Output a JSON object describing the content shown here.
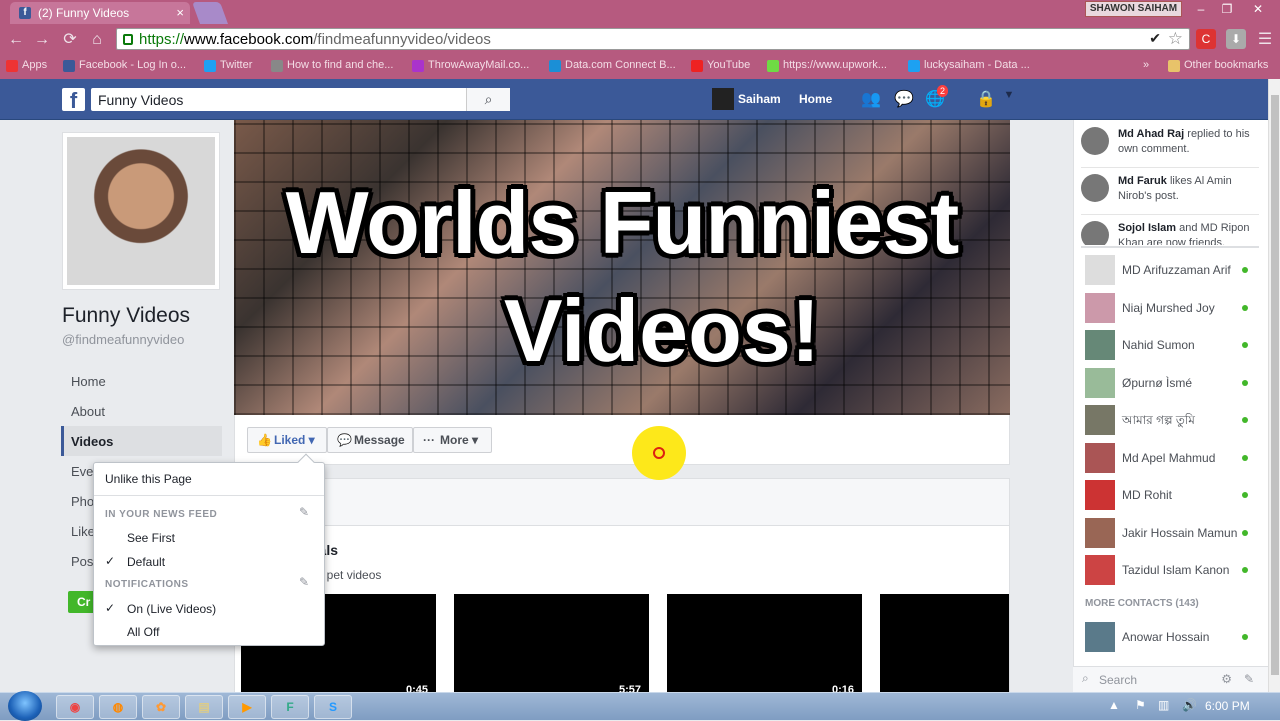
{
  "browser": {
    "tab_title": "(2) Funny Videos",
    "tab_close": "×",
    "user_chip": "SHAWON SAIHAM",
    "window_buttons": [
      "–",
      "❐",
      "✕"
    ],
    "nav": [
      "←",
      "→",
      "⟳",
      "⌂"
    ],
    "url_https": "https://",
    "url_host": "www.facebook.com",
    "url_path": "/findmeafunnyvideo/videos",
    "menu_glyph": "☰",
    "bookmarks": [
      {
        "label": "Apps",
        "color": "#e33"
      },
      {
        "label": "Facebook - Log In o...",
        "color": "#3b5998"
      },
      {
        "label": "Twitter",
        "color": "#1da1f2"
      },
      {
        "label": "How to find and che...",
        "color": "#888"
      },
      {
        "label": "ThrowAwayMail.co...",
        "color": "#a3c"
      },
      {
        "label": "Data.com Connect B...",
        "color": "#1b8fd6"
      },
      {
        "label": "YouTube",
        "color": "#e22"
      },
      {
        "label": "https://www.upwork...",
        "color": "#6fda44"
      },
      {
        "label": "luckysaiham - Data ...",
        "color": "#1da1f2"
      }
    ],
    "bookmarks_overflow": "»",
    "other_bookmarks": "Other bookmarks"
  },
  "fb": {
    "logo": "f",
    "search_value": "Funny Videos",
    "search_icon": "⌕",
    "user_name": "Saiham",
    "home_label": "Home",
    "notif_count": "2",
    "icons": [
      "friends-icon",
      "messages-icon",
      "globe-icon",
      "lock-icon",
      "caret-icon"
    ]
  },
  "page": {
    "name": "Funny Videos",
    "handle": "@findmeafunnyvideo",
    "nav": [
      "Home",
      "About",
      "Videos",
      "Eve",
      "Pho",
      "Like",
      "Pos"
    ],
    "create_label": "Cr",
    "cover_line1": "Worlds Funniest",
    "cover_line2": "Videos!"
  },
  "actions": {
    "liked": "Liked ▾",
    "message": "Message",
    "more": "More ▾"
  },
  "dropdown": {
    "unlike": "Unlike this Page",
    "news_feed_header": "IN YOUR NEWS FEED",
    "see_first": "See First",
    "default": "Default",
    "notifications_header": "NOTIFICATIONS",
    "on_live": "On (Live Videos)",
    "all_off": "All Off",
    "check": "✓",
    "pencil": "✎"
  },
  "section": {
    "title": "nals",
    "subtitle": "nd pet videos",
    "durations": [
      "0:45",
      "5:57",
      "0:16",
      ""
    ]
  },
  "ticker": [
    {
      "name": "Md Ahad Raj",
      "text": " replied to his own comment."
    },
    {
      "name": "Md Faruk",
      "text": " likes Al Amin Nirob's post."
    },
    {
      "name": "Sojol Islam",
      "text": " and MD Ripon Khan are now friends."
    }
  ],
  "contacts": [
    "MD Arifuzzaman Arif",
    "Niaj Murshed Joy",
    "Nahid Sumon",
    "Øpurnø Ìsmé",
    "আমার গল্প তুমি",
    "Md Apel Mahmud",
    "MD Rohit",
    "Jakir Hossain Mamun",
    "Tazidul Islam Kanon"
  ],
  "more_contacts": "MORE CONTACTS (143)",
  "more_contact_list": [
    "Anowar Hossain"
  ],
  "chat_search_placeholder": "Search",
  "taskbar": {
    "clock": "6:00 PM",
    "apps": [
      "chrome-app",
      "firefox-app",
      "paint-app",
      "explorer-app",
      "media-app",
      "f-app",
      "skype-app"
    ]
  }
}
